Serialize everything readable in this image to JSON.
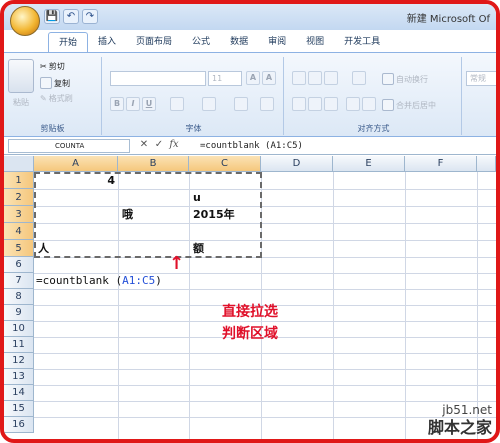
{
  "window": {
    "title": "新建 Microsoft Of"
  },
  "qat": {
    "save": "💾",
    "undo": "↶",
    "redo": "↷"
  },
  "ribbon": {
    "tabs": [
      "开始",
      "插入",
      "页面布局",
      "公式",
      "数据",
      "审阅",
      "视图",
      "开发工具"
    ],
    "active_tab": "开始",
    "clipboard": {
      "paste": "粘贴",
      "cut": "剪切",
      "copy": "复制",
      "format_painter": "格式刷",
      "group": "剪贴板"
    },
    "font": {
      "size": "11",
      "grow": "A",
      "shrink": "A",
      "bold": "B",
      "italic": "I",
      "underline": "U",
      "group": "字体"
    },
    "alignment": {
      "wrap": "自动换行",
      "merge": "合并后居中",
      "group": "对齐方式"
    },
    "number": {
      "format": "常规"
    }
  },
  "formula_bar": {
    "name_box": "COUNTA",
    "cancel": "✕",
    "enter": "✓",
    "fx": "fx",
    "formula": "=countblank (A1:C5)"
  },
  "sheet": {
    "columns": [
      "A",
      "B",
      "C",
      "D",
      "E",
      "F"
    ],
    "rows": [
      "1",
      "2",
      "3",
      "4",
      "5",
      "6",
      "7",
      "8",
      "9",
      "10",
      "11",
      "12",
      "13",
      "14",
      "15",
      "16"
    ],
    "cells": {
      "A1": "4",
      "C2": "u",
      "B3": "哦",
      "C3": "2015年",
      "A5": "人",
      "C5": "额"
    },
    "active_formula": {
      "prefix": "=countblank (",
      "ref": "A1:C5",
      "suffix": ")"
    }
  },
  "annotation": {
    "line1": "直接拉选",
    "line2": "判断区域",
    "arrow": "↑"
  },
  "watermark": {
    "site": "jb51.net",
    "name": "脚本之家"
  }
}
